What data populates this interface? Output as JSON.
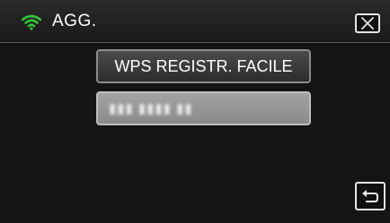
{
  "header": {
    "title": "AGG.",
    "wifi_icon": "wifi-icon",
    "wifi_color": "#36c23a",
    "close_icon": "close-icon"
  },
  "menu": {
    "wps_label": "WPS REGISTR. FACILE",
    "network_label": "▮▮▮ ▮▮▮▮ ▮▮"
  },
  "footer": {
    "back_icon": "return-icon"
  }
}
